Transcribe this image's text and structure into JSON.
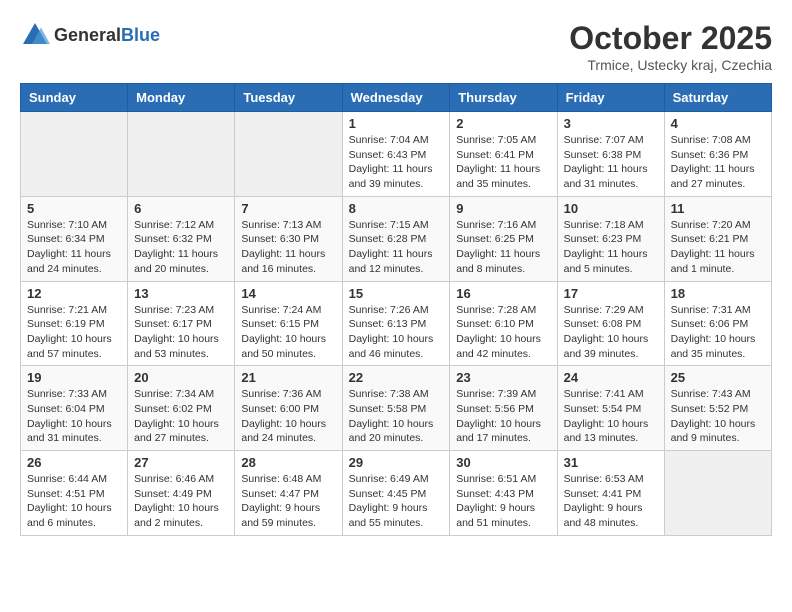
{
  "header": {
    "logo_general": "General",
    "logo_blue": "Blue",
    "month_title": "October 2025",
    "location": "Trmice, Ustecky kraj, Czechia"
  },
  "weekdays": [
    "Sunday",
    "Monday",
    "Tuesday",
    "Wednesday",
    "Thursday",
    "Friday",
    "Saturday"
  ],
  "weeks": [
    [
      {
        "day": "",
        "info": ""
      },
      {
        "day": "",
        "info": ""
      },
      {
        "day": "",
        "info": ""
      },
      {
        "day": "1",
        "info": "Sunrise: 7:04 AM\nSunset: 6:43 PM\nDaylight: 11 hours\nand 39 minutes."
      },
      {
        "day": "2",
        "info": "Sunrise: 7:05 AM\nSunset: 6:41 PM\nDaylight: 11 hours\nand 35 minutes."
      },
      {
        "day": "3",
        "info": "Sunrise: 7:07 AM\nSunset: 6:38 PM\nDaylight: 11 hours\nand 31 minutes."
      },
      {
        "day": "4",
        "info": "Sunrise: 7:08 AM\nSunset: 6:36 PM\nDaylight: 11 hours\nand 27 minutes."
      }
    ],
    [
      {
        "day": "5",
        "info": "Sunrise: 7:10 AM\nSunset: 6:34 PM\nDaylight: 11 hours\nand 24 minutes."
      },
      {
        "day": "6",
        "info": "Sunrise: 7:12 AM\nSunset: 6:32 PM\nDaylight: 11 hours\nand 20 minutes."
      },
      {
        "day": "7",
        "info": "Sunrise: 7:13 AM\nSunset: 6:30 PM\nDaylight: 11 hours\nand 16 minutes."
      },
      {
        "day": "8",
        "info": "Sunrise: 7:15 AM\nSunset: 6:28 PM\nDaylight: 11 hours\nand 12 minutes."
      },
      {
        "day": "9",
        "info": "Sunrise: 7:16 AM\nSunset: 6:25 PM\nDaylight: 11 hours\nand 8 minutes."
      },
      {
        "day": "10",
        "info": "Sunrise: 7:18 AM\nSunset: 6:23 PM\nDaylight: 11 hours\nand 5 minutes."
      },
      {
        "day": "11",
        "info": "Sunrise: 7:20 AM\nSunset: 6:21 PM\nDaylight: 11 hours\nand 1 minute."
      }
    ],
    [
      {
        "day": "12",
        "info": "Sunrise: 7:21 AM\nSunset: 6:19 PM\nDaylight: 10 hours\nand 57 minutes."
      },
      {
        "day": "13",
        "info": "Sunrise: 7:23 AM\nSunset: 6:17 PM\nDaylight: 10 hours\nand 53 minutes."
      },
      {
        "day": "14",
        "info": "Sunrise: 7:24 AM\nSunset: 6:15 PM\nDaylight: 10 hours\nand 50 minutes."
      },
      {
        "day": "15",
        "info": "Sunrise: 7:26 AM\nSunset: 6:13 PM\nDaylight: 10 hours\nand 46 minutes."
      },
      {
        "day": "16",
        "info": "Sunrise: 7:28 AM\nSunset: 6:10 PM\nDaylight: 10 hours\nand 42 minutes."
      },
      {
        "day": "17",
        "info": "Sunrise: 7:29 AM\nSunset: 6:08 PM\nDaylight: 10 hours\nand 39 minutes."
      },
      {
        "day": "18",
        "info": "Sunrise: 7:31 AM\nSunset: 6:06 PM\nDaylight: 10 hours\nand 35 minutes."
      }
    ],
    [
      {
        "day": "19",
        "info": "Sunrise: 7:33 AM\nSunset: 6:04 PM\nDaylight: 10 hours\nand 31 minutes."
      },
      {
        "day": "20",
        "info": "Sunrise: 7:34 AM\nSunset: 6:02 PM\nDaylight: 10 hours\nand 27 minutes."
      },
      {
        "day": "21",
        "info": "Sunrise: 7:36 AM\nSunset: 6:00 PM\nDaylight: 10 hours\nand 24 minutes."
      },
      {
        "day": "22",
        "info": "Sunrise: 7:38 AM\nSunset: 5:58 PM\nDaylight: 10 hours\nand 20 minutes."
      },
      {
        "day": "23",
        "info": "Sunrise: 7:39 AM\nSunset: 5:56 PM\nDaylight: 10 hours\nand 17 minutes."
      },
      {
        "day": "24",
        "info": "Sunrise: 7:41 AM\nSunset: 5:54 PM\nDaylight: 10 hours\nand 13 minutes."
      },
      {
        "day": "25",
        "info": "Sunrise: 7:43 AM\nSunset: 5:52 PM\nDaylight: 10 hours\nand 9 minutes."
      }
    ],
    [
      {
        "day": "26",
        "info": "Sunrise: 6:44 AM\nSunset: 4:51 PM\nDaylight: 10 hours\nand 6 minutes."
      },
      {
        "day": "27",
        "info": "Sunrise: 6:46 AM\nSunset: 4:49 PM\nDaylight: 10 hours\nand 2 minutes."
      },
      {
        "day": "28",
        "info": "Sunrise: 6:48 AM\nSunset: 4:47 PM\nDaylight: 9 hours\nand 59 minutes."
      },
      {
        "day": "29",
        "info": "Sunrise: 6:49 AM\nSunset: 4:45 PM\nDaylight: 9 hours\nand 55 minutes."
      },
      {
        "day": "30",
        "info": "Sunrise: 6:51 AM\nSunset: 4:43 PM\nDaylight: 9 hours\nand 51 minutes."
      },
      {
        "day": "31",
        "info": "Sunrise: 6:53 AM\nSunset: 4:41 PM\nDaylight: 9 hours\nand 48 minutes."
      },
      {
        "day": "",
        "info": ""
      }
    ]
  ]
}
